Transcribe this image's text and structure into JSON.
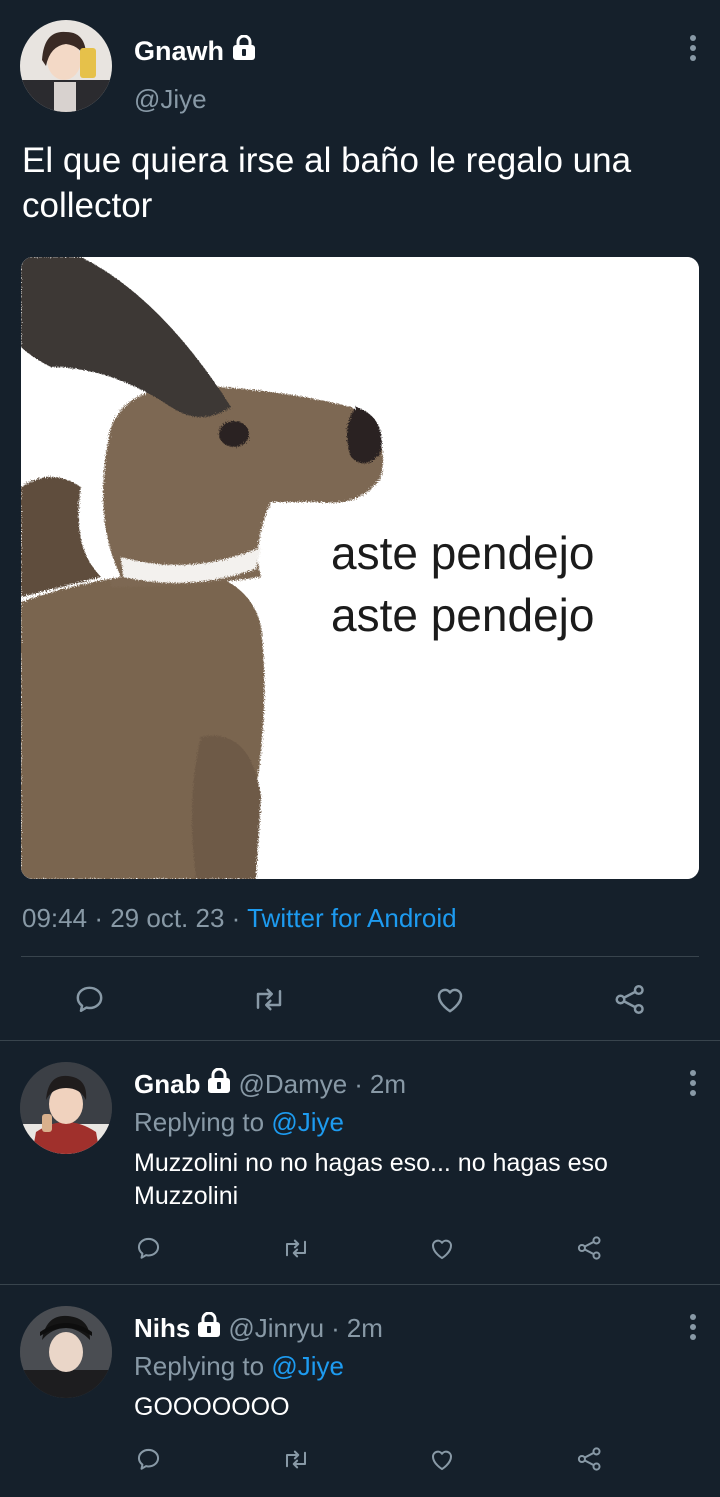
{
  "main_tweet": {
    "author_name": "Gnawh",
    "author_handle": "@Jiye",
    "text": "El que quiera irse al baño le regalo una collector",
    "media_caption_line1": "aste pendejo",
    "media_caption_line2": "aste pendejo",
    "time": "09:44",
    "separator1": "·",
    "date": "29 oct. 23",
    "separator2": "·",
    "source": "Twitter for Android"
  },
  "replies": [
    {
      "author_name": "Gnab",
      "author_handle": "@Damye",
      "separator": "·",
      "age": "2m",
      "replying_label": "Replying to",
      "replying_handle": "@Jiye",
      "text": "Muzzolini no no hagas eso... no hagas eso Muzzolini"
    },
    {
      "author_name": "Nihs",
      "author_handle": "@Jinryu",
      "separator": "·",
      "age": "2m",
      "replying_label": "Replying to",
      "replying_handle": "@Jiye",
      "text": "GOOOOOOO"
    }
  ],
  "icons": [
    "lock-icon",
    "more-icon",
    "reply-icon",
    "retweet-icon",
    "like-icon",
    "share-icon"
  ],
  "colors": {
    "background": "#15202b",
    "text": "#ffffff",
    "muted": "#8899a6",
    "link": "#1d9bf0",
    "divider": "#38444d"
  }
}
